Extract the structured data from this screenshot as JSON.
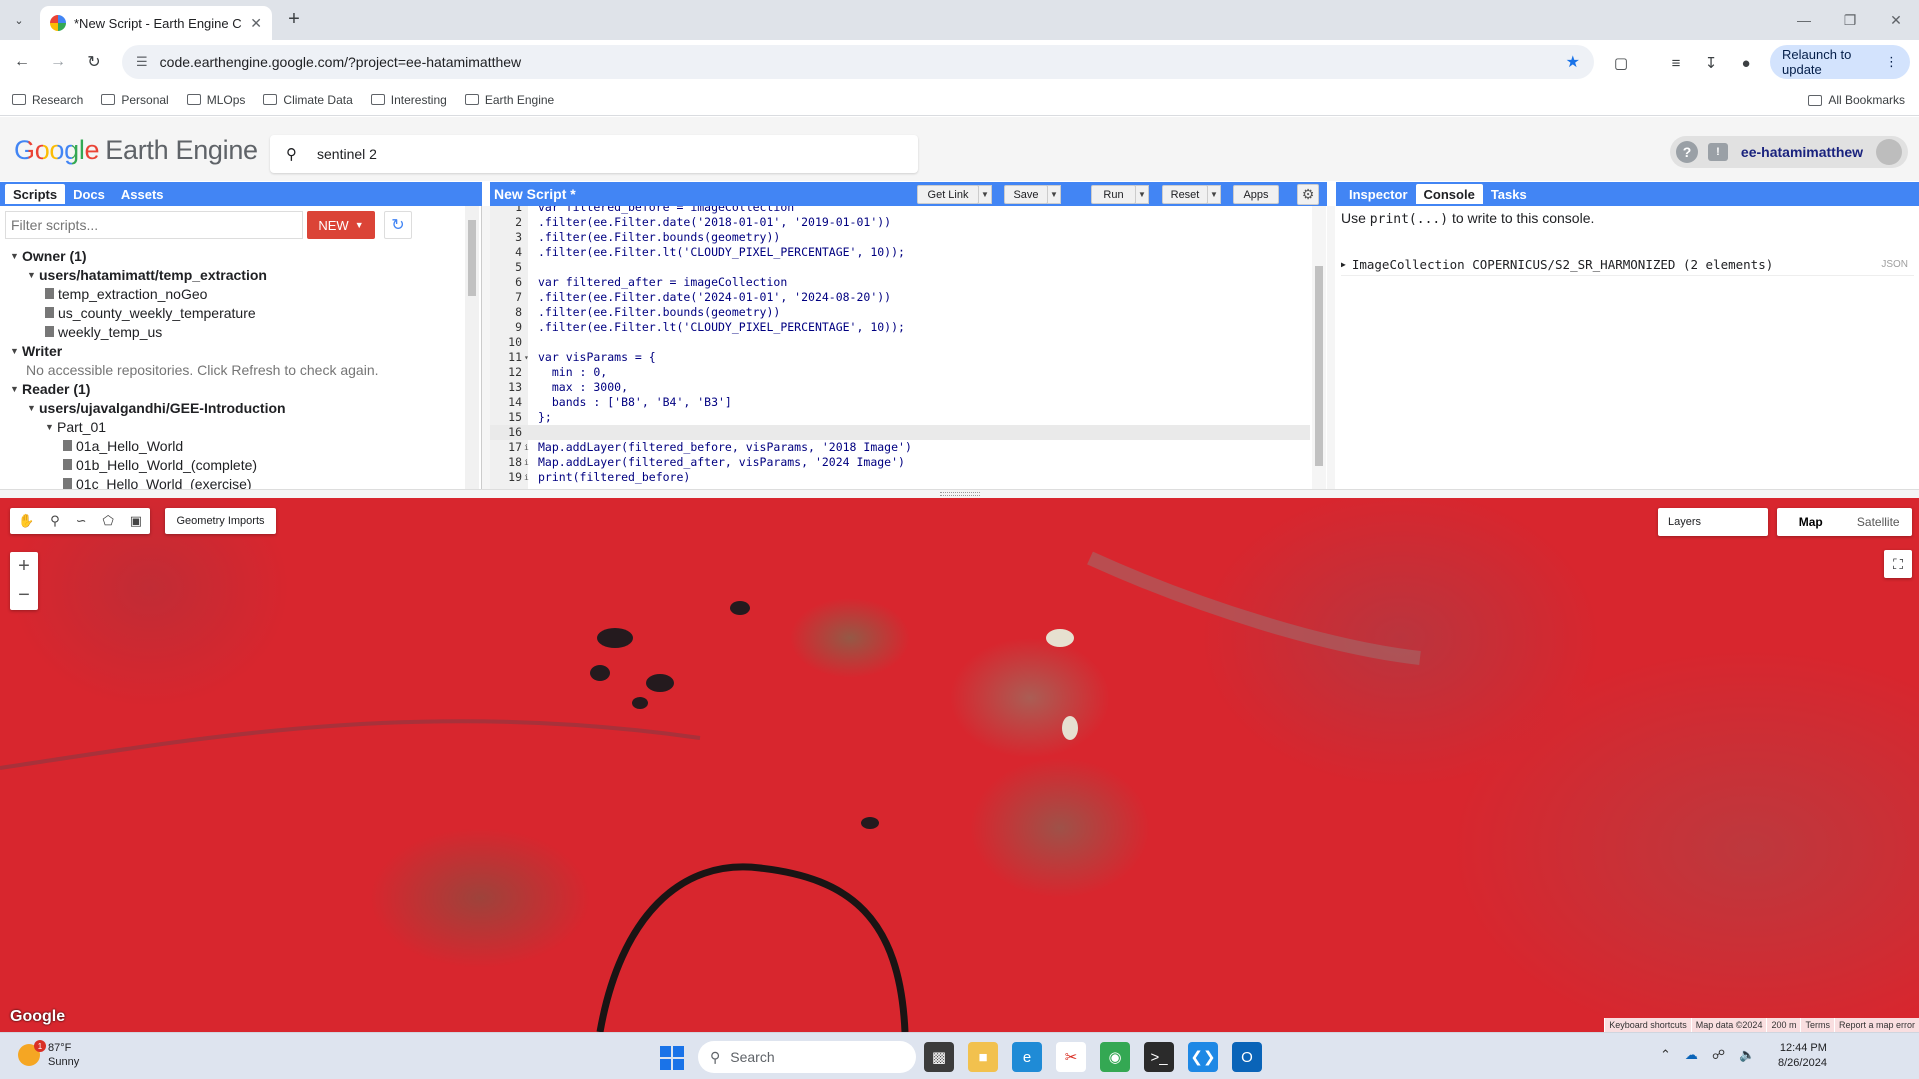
{
  "browser": {
    "tab_title": "*New Script - Earth Engine Cod",
    "url": "code.earthengine.google.com/?project=ee-hatamimatthew",
    "relaunch_label": "Relaunch to update",
    "bookmarks": [
      "Research",
      "Personal",
      "MLOps",
      "Climate Data",
      "Interesting",
      "Earth Engine"
    ],
    "all_bookmarks_label": "All Bookmarks"
  },
  "header": {
    "logo_google": "Google",
    "logo_product": "Earth Engine",
    "search_value": "sentinel 2",
    "help_icon_glyph": "?",
    "feedback_icon_glyph": "!",
    "username": "ee-hatamimatthew"
  },
  "left_panel": {
    "tabs": [
      "Scripts",
      "Docs",
      "Assets"
    ],
    "active_tab": "Scripts",
    "filter_placeholder": "Filter scripts...",
    "new_button": "NEW",
    "tree": [
      {
        "label": "Owner (1)",
        "level": 0,
        "kind": "section"
      },
      {
        "label": "users/hatamimatt/temp_extraction",
        "level": 1,
        "kind": "repo"
      },
      {
        "label": "temp_extraction_noGeo",
        "level": 2,
        "kind": "file"
      },
      {
        "label": "us_county_weekly_temperature",
        "level": 2,
        "kind": "file"
      },
      {
        "label": "weekly_temp_us",
        "level": 2,
        "kind": "file"
      },
      {
        "label": "Writer",
        "level": 0,
        "kind": "section"
      },
      {
        "label": "No accessible repositories. Click Refresh to check again.",
        "level": 1,
        "kind": "note"
      },
      {
        "label": "Reader (1)",
        "level": 0,
        "kind": "section"
      },
      {
        "label": "users/ujavalgandhi/GEE-Introduction",
        "level": 1,
        "kind": "repo"
      },
      {
        "label": "Part_01",
        "level": 2,
        "kind": "folder"
      },
      {
        "label": "01a_Hello_World",
        "level": 3,
        "kind": "file"
      },
      {
        "label": "01b_Hello_World_(complete)",
        "level": 3,
        "kind": "file"
      },
      {
        "label": "01c_Hello_World_(exercise)",
        "level": 3,
        "kind": "file"
      }
    ]
  },
  "editor": {
    "title": "New Script *",
    "buttons": {
      "get_link": "Get Link",
      "save": "Save",
      "run": "Run",
      "reset": "Reset",
      "apps": "Apps"
    },
    "lines": [
      {
        "n": "1",
        "text": "var filtered_before = imageCollection"
      },
      {
        "n": "2",
        "text": ".filter(ee.Filter.date('2018-01-01', '2019-01-01'))"
      },
      {
        "n": "3",
        "text": ".filter(ee.Filter.bounds(geometry))"
      },
      {
        "n": "4",
        "text": ".filter(ee.Filter.lt('CLOUDY_PIXEL_PERCENTAGE', 10));"
      },
      {
        "n": "5",
        "text": ""
      },
      {
        "n": "6",
        "text": "var filtered_after = imageCollection"
      },
      {
        "n": "7",
        "text": ".filter(ee.Filter.date('2024-01-01', '2024-08-20'))"
      },
      {
        "n": "8",
        "text": ".filter(ee.Filter.bounds(geometry))"
      },
      {
        "n": "9",
        "text": ".filter(ee.Filter.lt('CLOUDY_PIXEL_PERCENTAGE', 10));"
      },
      {
        "n": "10",
        "text": ""
      },
      {
        "n": "11",
        "text": "var visParams = {"
      },
      {
        "n": "12",
        "text": "  min : 0,"
      },
      {
        "n": "13",
        "text": "  max : 3000,"
      },
      {
        "n": "14",
        "text": "  bands : ['B8', 'B4', 'B3']"
      },
      {
        "n": "15",
        "text": "};"
      },
      {
        "n": "16",
        "text": ""
      },
      {
        "n": "17",
        "text": "Map.addLayer(filtered_before, visParams, '2018 Image')"
      },
      {
        "n": "18",
        "text": "Map.addLayer(filtered_after, visParams, '2024 Image')"
      },
      {
        "n": "19",
        "text": "print(filtered_before)"
      }
    ]
  },
  "console": {
    "tabs": [
      "Inspector",
      "Console",
      "Tasks"
    ],
    "active_tab": "Console",
    "hint_prefix": "Use ",
    "hint_code": "print(...)",
    "hint_suffix": " to write to this console.",
    "entry": "ImageCollection COPERNICUS/S2_SR_HARMONIZED (2 elements)",
    "entry_tag": "JSON"
  },
  "map": {
    "geometry_imports": "Geometry Imports",
    "layers_label": "Layers",
    "map_type_options": [
      "Map",
      "Satellite"
    ],
    "selected_map_type": "Map",
    "watermark": "Google",
    "attribution": [
      "Keyboard shortcuts",
      "Map data ©2024",
      "200 m",
      "Terms",
      "Report a map error"
    ]
  },
  "taskbar": {
    "temperature": "87°F",
    "condition": "Sunny",
    "weather_badge": "1",
    "search_placeholder": "Search",
    "time": "12:44 PM",
    "date": "8/26/2024"
  }
}
